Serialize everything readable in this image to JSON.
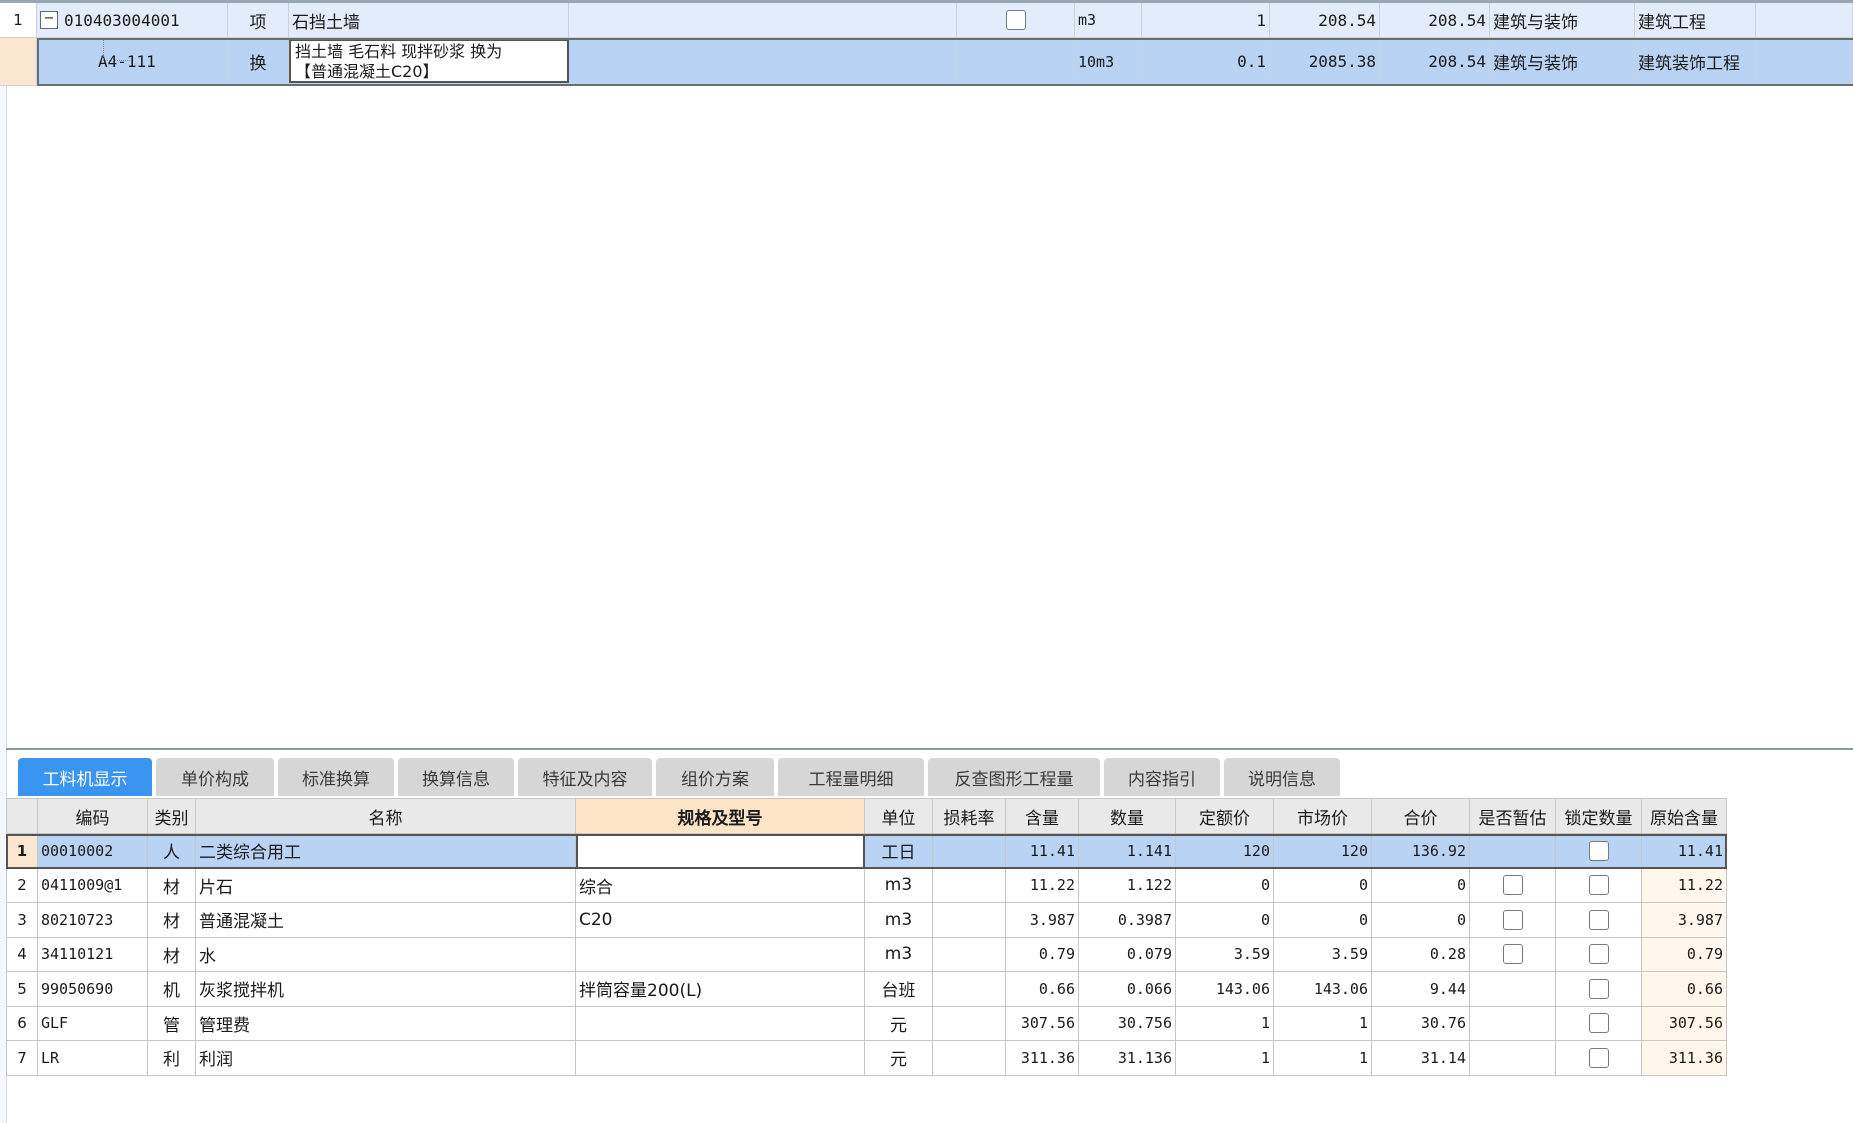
{
  "top_grid": {
    "rows": [
      {
        "index": "1",
        "code": "010403004001",
        "type": "项",
        "name": "石挡土墙",
        "unit": "m3",
        "quantity": "1",
        "unit_price": "208.54",
        "total": "208.54",
        "major": "建筑与装饰",
        "category": "建筑工程"
      },
      {
        "index": "",
        "code": "A4-111",
        "type": "换",
        "name_line1": "挡土墙 毛石料 现拌砂浆  换为",
        "name_line2": "【普通混凝土C20】",
        "unit": "10m3",
        "quantity": "0.1",
        "unit_price": "2085.38",
        "total": "208.54",
        "major": "建筑与装饰",
        "category": "建筑装饰工程"
      }
    ]
  },
  "tabs": [
    {
      "label": "工料机显示",
      "active": true
    },
    {
      "label": "单价构成",
      "active": false
    },
    {
      "label": "标准换算",
      "active": false
    },
    {
      "label": "换算信息",
      "active": false
    },
    {
      "label": "特征及内容",
      "active": false
    },
    {
      "label": "组价方案",
      "active": false
    },
    {
      "label": "工程量明细",
      "active": false
    },
    {
      "label": "反查图形工程量",
      "active": false
    },
    {
      "label": "内容指引",
      "active": false
    },
    {
      "label": "说明信息",
      "active": false
    }
  ],
  "bottom_grid": {
    "headers": {
      "code": "编码",
      "cat": "类别",
      "name": "名称",
      "spec": "规格及型号",
      "unit": "单位",
      "loss": "损耗率",
      "content": "含量",
      "qty": "数量",
      "quota_price": "定额价",
      "market_price": "市场价",
      "total": "合价",
      "provisional": "是否暂估",
      "lock": "锁定数量",
      "orig_content": "原始含量"
    },
    "rows": [
      {
        "index": "1",
        "code": "00010002",
        "cat": "人",
        "name": "二类综合用工",
        "spec": "",
        "unit": "工日",
        "loss": "",
        "content": "11.41",
        "qty": "1.141",
        "quota_price": "120",
        "market_price": "120",
        "total": "136.92",
        "has_provisional": false,
        "orig_content": "11.41"
      },
      {
        "index": "2",
        "code": "0411009@1",
        "cat": "材",
        "name": "片石",
        "spec": "综合",
        "unit": "m3",
        "loss": "",
        "content": "11.22",
        "qty": "1.122",
        "quota_price": "0",
        "market_price": "0",
        "total": "0",
        "has_provisional": true,
        "orig_content": "11.22"
      },
      {
        "index": "3",
        "code": "80210723",
        "cat": "材",
        "name": "普通混凝土",
        "spec": "C20",
        "unit": "m3",
        "loss": "",
        "content": "3.987",
        "qty": "0.3987",
        "quota_price": "0",
        "market_price": "0",
        "total": "0",
        "has_provisional": true,
        "orig_content": "3.987"
      },
      {
        "index": "4",
        "code": "34110121",
        "cat": "材",
        "name": "水",
        "spec": "",
        "unit": "m3",
        "loss": "",
        "content": "0.79",
        "qty": "0.079",
        "quota_price": "3.59",
        "market_price": "3.59",
        "total": "0.28",
        "has_provisional": true,
        "orig_content": "0.79"
      },
      {
        "index": "5",
        "code": "99050690",
        "cat": "机",
        "name": "灰浆搅拌机",
        "spec": "拌筒容量200(L)",
        "unit": "台班",
        "loss": "",
        "content": "0.66",
        "qty": "0.066",
        "quota_price": "143.06",
        "market_price": "143.06",
        "total": "9.44",
        "has_provisional": false,
        "orig_content": "0.66"
      },
      {
        "index": "6",
        "code": "GLF",
        "cat": "管",
        "name": "管理费",
        "spec": "",
        "unit": "元",
        "loss": "",
        "content": "307.56",
        "qty": "30.756",
        "quota_price": "1",
        "market_price": "1",
        "total": "30.76",
        "has_provisional": false,
        "orig_content": "307.56"
      },
      {
        "index": "7",
        "code": "LR",
        "cat": "利",
        "name": "利润",
        "spec": "",
        "unit": "元",
        "loss": "",
        "content": "311.36",
        "qty": "31.136",
        "quota_price": "1",
        "market_price": "1",
        "total": "31.14",
        "has_provisional": false,
        "orig_content": "311.36"
      }
    ]
  },
  "colors": {
    "tab_active": "#3a95f0",
    "row_selected": "#b9d3f5",
    "header_highlight": "#fde4c7"
  }
}
